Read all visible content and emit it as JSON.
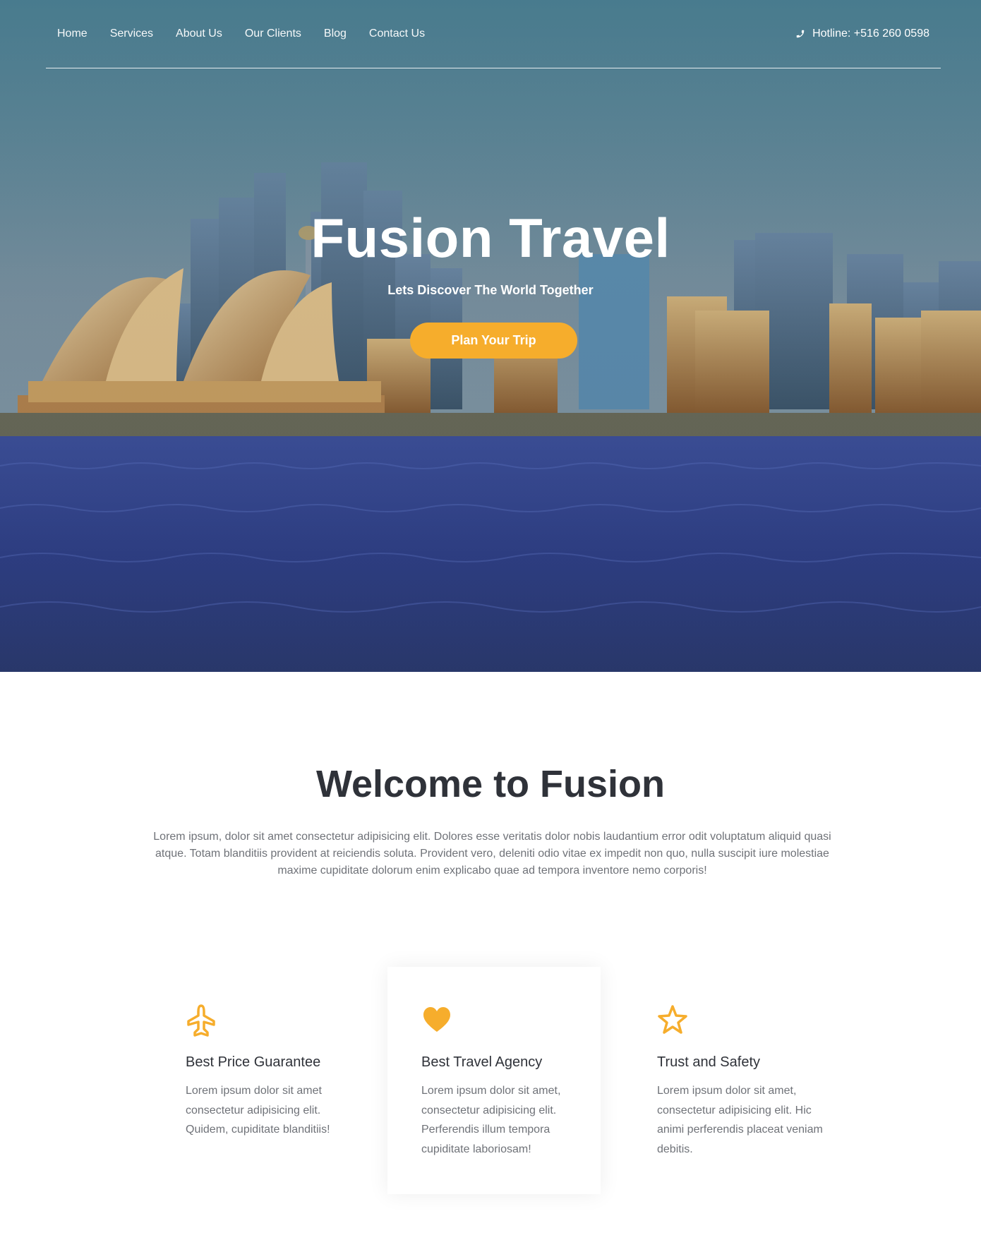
{
  "nav": {
    "items": [
      "Home",
      "Services",
      "About Us",
      "Our Clients",
      "Blog",
      "Contact Us"
    ],
    "hotline": "Hotline: +516 260 0598",
    "hotline_icon": "phone-icon"
  },
  "hero": {
    "title": "Fusion Travel",
    "subtitle": "Lets Discover The World Together",
    "cta_label": "Plan Your Trip",
    "accent_color": "#f6ad2c"
  },
  "welcome": {
    "title": "Welcome to Fusion",
    "text": "Lorem ipsum, dolor sit amet consectetur adipisicing elit. Dolores esse veritatis dolor nobis laudantium error odit voluptatum aliquid quasi atque. Totam blanditiis provident at reiciendis soluta. Provident vero, deleniti odio vitae ex impedit non quo, nulla suscipit iure molestiae maxime cupiditate dolorum enim explicabo quae ad tempora inventore nemo corporis!"
  },
  "features": [
    {
      "icon": "airplane-icon",
      "title": "Best Price Guarantee",
      "text": "Lorem ipsum dolor sit amet consectetur adipisicing elit. Quidem, cupiditate blanditiis!"
    },
    {
      "icon": "heart-icon",
      "title": "Best Travel Agency",
      "text": "Lorem ipsum dolor sit amet, consectetur adipisicing elit. Perferendis illum tempora cupiditate laboriosam!"
    },
    {
      "icon": "star-icon",
      "title": "Trust and Safety",
      "text": "Lorem ipsum dolor sit amet, consectetur adipisicing elit. Hic animi perferendis placeat veniam debitis."
    }
  ]
}
